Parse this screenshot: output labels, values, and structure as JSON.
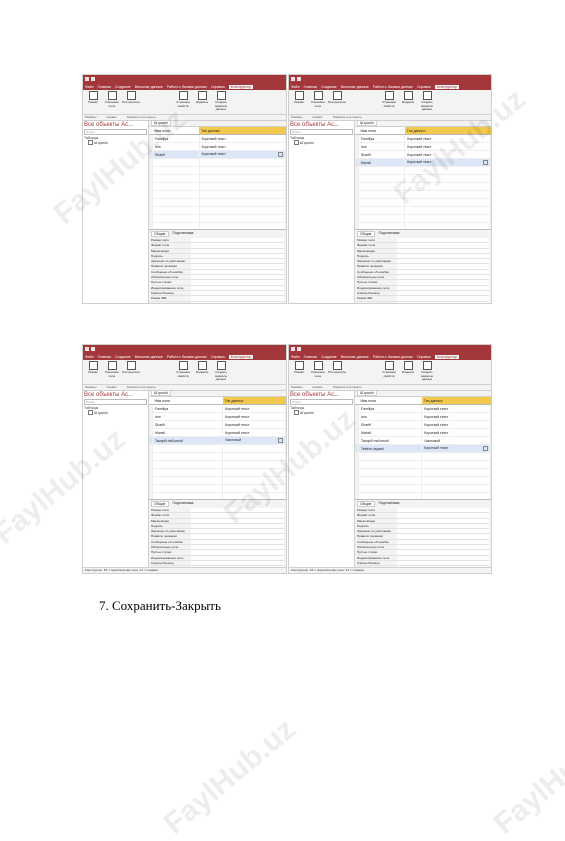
{
  "app": {
    "menu_tabs": [
      "Файл",
      "Главная",
      "Создание",
      "Внешние данные",
      "Работа с базами данных",
      "Справка",
      "Конструктор"
    ],
    "ribbon_buttons": [
      "Режим",
      "Ключевое поле",
      "Построитель",
      "Проверить правила",
      "Страница свойств",
      "Индексы",
      "Создать макросы данных"
    ],
    "ribbon_groups": [
      "Режимы",
      "Сервис",
      "Показать или скрыть"
    ],
    "nav_title": "Все объекты Ac...",
    "nav_search": "Поиск...",
    "nav_category": "Таблицы",
    "nav_table": "Ш'quvchi",
    "tab_label": "Ш'quvchi",
    "col_field": "Имя поля",
    "col_type": "Тип данных",
    "prop_tabs": [
      "Общие",
      "Подстановка"
    ],
    "prop_names": [
      "Размер поля",
      "Формат поля",
      "Маска ввода",
      "Подпись",
      "Значение по умолчанию",
      "Правило проверки",
      "Сообщение об ошибке",
      "Обязательное поле",
      "Пустые строки",
      "Индексированное поле",
      "Сжатие Юникод",
      "Режим IME",
      "Режим предложений IME",
      "Выравнивание текста"
    ],
    "status": "Конструктор. F6 = переключение окон. F1 = справка."
  },
  "screens": [
    {
      "rows": [
        {
          "name": "Familiya",
          "type": "Короткий текст"
        },
        {
          "name": "Ism",
          "type": "Короткий текст"
        },
        {
          "name": "Sharifi",
          "type": "Короткий текст"
        }
      ]
    },
    {
      "rows": [
        {
          "name": "Familiya",
          "type": "Короткий текст"
        },
        {
          "name": "Ism",
          "type": "Короткий текст"
        },
        {
          "name": "Sharifi",
          "type": "Короткий текст"
        },
        {
          "name": "Manzil",
          "type": "Короткий текст"
        }
      ]
    },
    {
      "rows": [
        {
          "name": "Familiya",
          "type": "Короткий текст"
        },
        {
          "name": "Ism",
          "type": "Короткий текст"
        },
        {
          "name": "Sharifi",
          "type": "Короткий текст"
        },
        {
          "name": "Manzil",
          "type": "Короткий текст"
        },
        {
          "name": "Tavqulli ma'lumoti",
          "type": "Числовой"
        }
      ]
    },
    {
      "rows": [
        {
          "name": "Familiya",
          "type": "Короткий текст"
        },
        {
          "name": "Ism",
          "type": "Короткий текст"
        },
        {
          "name": "Sharifi",
          "type": "Короткий текст"
        },
        {
          "name": "Manzil",
          "type": "Короткий текст"
        },
        {
          "name": "Tavqulli ma'lumoti",
          "type": "Числовой"
        },
        {
          "name": "Telefon raqami",
          "type": "Короткий текст"
        }
      ]
    }
  ],
  "step_text": "7.  Сохранить-Закрыть",
  "watermark": "FaylHub.uz"
}
